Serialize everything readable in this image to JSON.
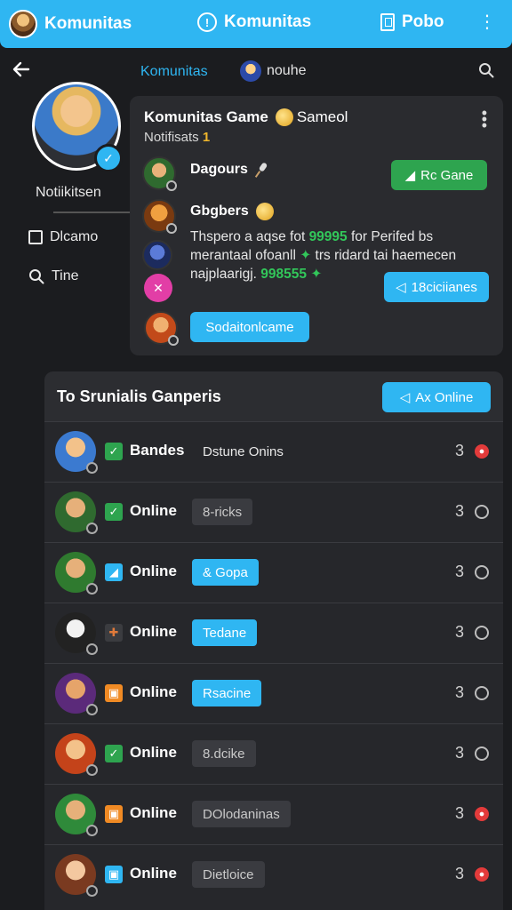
{
  "topbar": {
    "tab1": "Komunitas",
    "tab2": "Komunitas",
    "tab3": "Pobo",
    "menu": "⋮"
  },
  "subbar": {
    "active": "Komunitas",
    "user": "nouhe"
  },
  "profile": {
    "name": "Notiikitsen",
    "items": [
      "Dlcamo",
      "Tine"
    ]
  },
  "card": {
    "title": "Komunitas Game",
    "badge": "Sameol",
    "sub_label": "Notifisats",
    "sub_num": "1",
    "user1": "Dagours",
    "user2": "Gbgbers",
    "btn_game": "Rc Gane",
    "msg_pre": "Thspero a aqse fot",
    "msg_num1": "99995",
    "msg_mid": "for Perifed bs merantaal ofoanll",
    "msg_mid2": "trs ridard tai haemecen najplaarigj.",
    "msg_num2": "998555",
    "btn_bid": "18ciciianes",
    "btn_call": "Sodaitonlcame"
  },
  "members": {
    "title": "To Srunialis Ganperis",
    "action": "Ax Online",
    "rows": [
      {
        "label": "Bandes",
        "tag": "Dstune Onins",
        "count": "3"
      },
      {
        "label": "Online",
        "tag": "8-ricks",
        "count": "3"
      },
      {
        "label": "Online",
        "tag": "& Gopa",
        "count": "3"
      },
      {
        "label": "Online",
        "tag": "Tedane",
        "count": "3"
      },
      {
        "label": "Online",
        "tag": "Rsacine",
        "count": "3"
      },
      {
        "label": "Online",
        "tag": "8.dcike",
        "count": "3"
      },
      {
        "label": "Online",
        "tag": "DOlodaninas",
        "count": "3"
      },
      {
        "label": "Online",
        "tag": "Dietloice",
        "count": "3"
      }
    ]
  },
  "colors": {
    "accent": "#2fb6f2",
    "green": "#2ea44f",
    "background": "#1b1c1f",
    "red": "#e33b3b"
  }
}
